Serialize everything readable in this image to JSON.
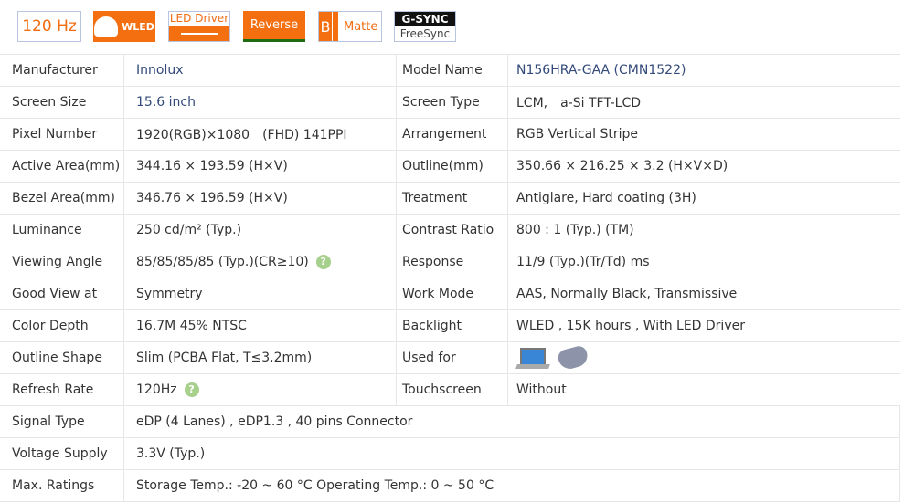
{
  "badges": {
    "hz": "120 Hz",
    "wled": "WLED",
    "led_driver": "LED Driver",
    "reverse": "Reverse",
    "matte_b": "B",
    "matte": "Matte",
    "gsync": "G-SYNC",
    "freesync": "FreeSync"
  },
  "specs": [
    {
      "l": "Manufacturer",
      "v": "Innolux",
      "l2": "Model Name",
      "v2": "N156HRA-GAA (CMN1522)"
    },
    {
      "l": "Screen Size",
      "v": "15.6 inch",
      "l2": "Screen Type",
      "v2": "LCM,　a-Si TFT-LCD"
    },
    {
      "l": "Pixel Number",
      "v": "1920(RGB)×1080　(FHD)  141PPI",
      "l2": "Arrangement",
      "v2": "RGB Vertical Stripe"
    },
    {
      "l": "Active Area(mm)",
      "v": "344.16 × 193.59 (H×V)",
      "l2": "Outline(mm)",
      "v2": "350.66 × 216.25 × 3.2 (H×V×D)"
    },
    {
      "l": "Bezel Area(mm)",
      "v": "346.76 × 196.59 (H×V)",
      "l2": "Treatment",
      "v2": "Antiglare, Hard coating (3H)"
    },
    {
      "l": "Luminance",
      "v": "250 cd/m² (Typ.)",
      "l2": "Contrast Ratio",
      "v2": "800 : 1 (Typ.) (TM)"
    },
    {
      "l": "Viewing Angle",
      "v": "85/85/85/85 (Typ.)(CR≥10)",
      "l2": "Response",
      "v2": "11/9 (Typ.)(Tr/Td) ms"
    },
    {
      "l": "Good View at",
      "v": "Symmetry",
      "l2": "Work Mode",
      "v2": "AAS, Normally Black, Transmissive"
    },
    {
      "l": "Color Depth",
      "v": "16.7M   45% NTSC",
      "l2": "Backlight",
      "v2": "WLED , 15K hours , With LED Driver"
    },
    {
      "l": "Outline Shape",
      "v": "Slim (PCBA Flat, T≤3.2mm)",
      "l2": "Used for",
      "v2": ""
    },
    {
      "l": "Refresh Rate",
      "v": "120Hz",
      "l2": "Touchscreen",
      "v2": "Without"
    },
    {
      "l": "Signal Type",
      "v": "eDP (4 Lanes) , eDP1.3 , 40 pins Connector"
    },
    {
      "l": "Voltage Supply",
      "v": "3.3V (Typ.)"
    },
    {
      "l": "Max. Ratings",
      "v": "Storage Temp.: -20 ~ 60 °C    Operating Temp.: 0 ~ 50 °C"
    }
  ],
  "help_icon": "?"
}
